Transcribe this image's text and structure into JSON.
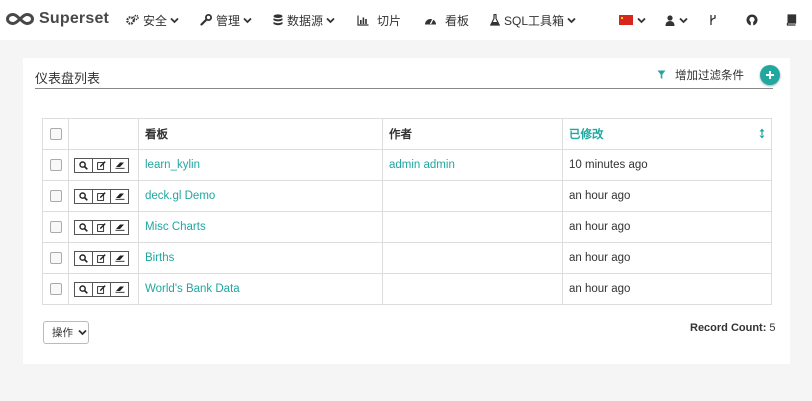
{
  "brand": {
    "name": "Superset"
  },
  "nav": {
    "security": "安全",
    "manage": "管理",
    "sources": "数据源",
    "slices": "切片",
    "dashboards": "看板",
    "sql_lab": "SQL工具箱"
  },
  "panel": {
    "title": "仪表盘列表",
    "add_filter": "增加过滤条件"
  },
  "table": {
    "headers": {
      "dashboard": "看板",
      "creator": "作者",
      "modified": "已修改"
    },
    "rows": [
      {
        "dashboard": "learn_kylin",
        "creator": "admin admin",
        "modified": "10 minutes ago"
      },
      {
        "dashboard": "deck.gl Demo",
        "creator": "",
        "modified": "an hour ago"
      },
      {
        "dashboard": "Misc Charts",
        "creator": "",
        "modified": "an hour ago"
      },
      {
        "dashboard": "Births",
        "creator": "",
        "modified": "an hour ago"
      },
      {
        "dashboard": "World's Bank Data",
        "creator": "",
        "modified": "an hour ago"
      }
    ]
  },
  "footer": {
    "actions_label": "操作",
    "record_count_label": "Record Count:",
    "record_count": "5"
  },
  "colors": {
    "accent": "#20a7a0",
    "flag": "#d7261e"
  },
  "icons": [
    "logo-icon",
    "gears-icon",
    "wrench-icon",
    "database-icon",
    "bar-chart-icon",
    "dashboard-icon",
    "flask-icon",
    "flag-icon",
    "user-icon",
    "code-branch-icon",
    "github-icon",
    "book-icon",
    "filter-icon",
    "plus-icon",
    "search-icon",
    "edit-icon",
    "eraser-icon",
    "sort-icon"
  ]
}
